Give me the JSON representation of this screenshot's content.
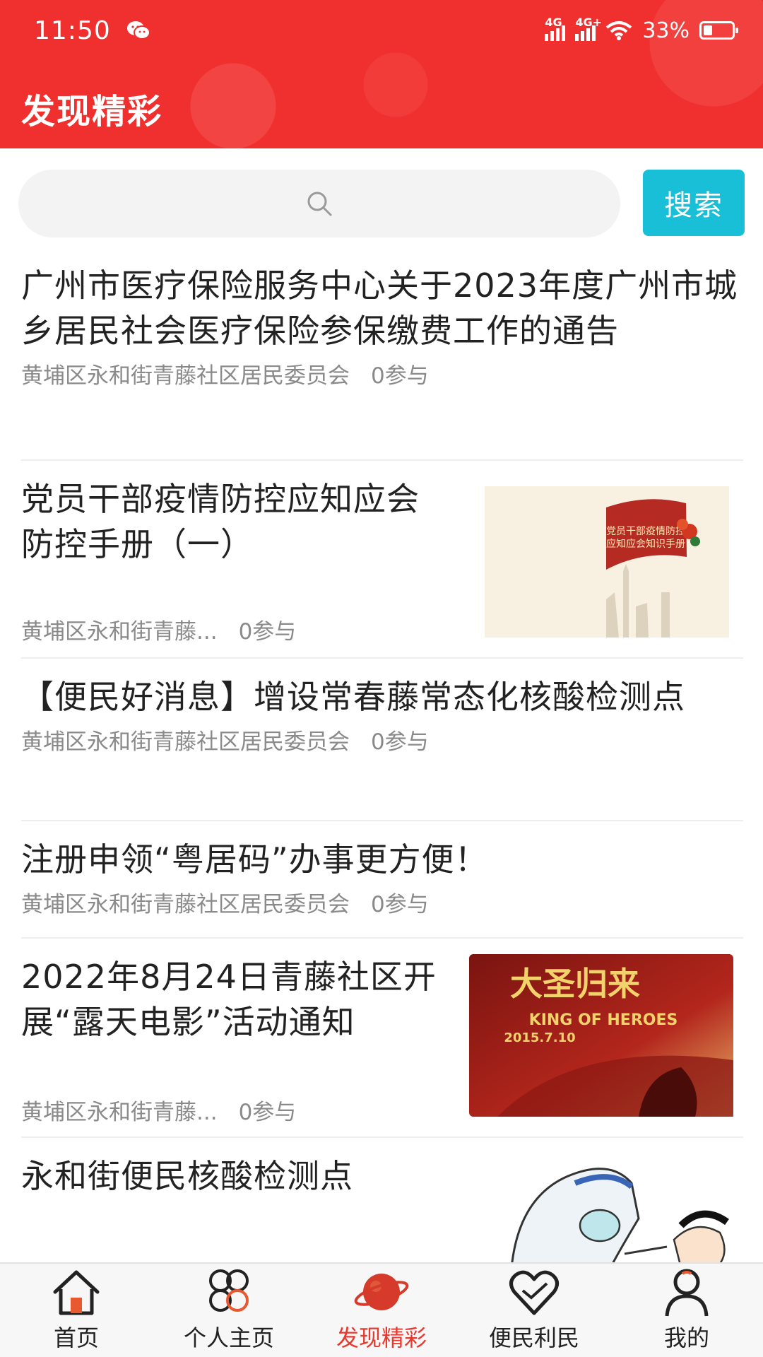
{
  "status_bar": {
    "time": "11:50",
    "signal_1": "4G",
    "signal_2": "4G+",
    "battery": "33%"
  },
  "header": {
    "title": "发现精彩"
  },
  "search": {
    "placeholder": "",
    "button_label": "搜索"
  },
  "items": [
    {
      "title": "广州市医疗保险服务中心关于2023年度广州市城乡居民社会医疗保险参保缴费工作的通告",
      "source": "黄埔区永和街青藤社区居民委员会",
      "participants": "0参与"
    },
    {
      "title": "党员干部疫情防控应知应会防控手册（一）",
      "source": "黄埔区永和街青藤...",
      "participants": "0参与",
      "thumb_text_1": "党员干部疫情防控",
      "thumb_text_2": "应知应会知识手册"
    },
    {
      "title": "【便民好消息】增设常春藤常态化核酸检测点",
      "source": "黄埔区永和街青藤社区居民委员会",
      "participants": "0参与"
    },
    {
      "title": "注册申领“粤居码”办事更方便！",
      "source": "黄埔区永和街青藤社区居民委员会",
      "participants": "0参与"
    },
    {
      "title": "2022年8月24日青藤社区开展“露天电影”活动通知",
      "source": "黄埔区永和街青藤...",
      "participants": "0参与",
      "thumb_text_1": "大圣归来",
      "thumb_text_2": "KING OF HEROES",
      "thumb_text_3": "2015.7.10"
    },
    {
      "title": "永和街便民核酸检测点"
    }
  ],
  "tabs": [
    {
      "label": "首页",
      "icon": "home-icon"
    },
    {
      "label": "个人主页",
      "icon": "clover-icon"
    },
    {
      "label": "发现精彩",
      "icon": "planet-icon"
    },
    {
      "label": "便民利民",
      "icon": "heart-icon"
    },
    {
      "label": "我的",
      "icon": "user-icon"
    }
  ],
  "colors": {
    "header": "#f0302e",
    "search_button": "#19bfd6",
    "active_tab": "#e8392f"
  }
}
